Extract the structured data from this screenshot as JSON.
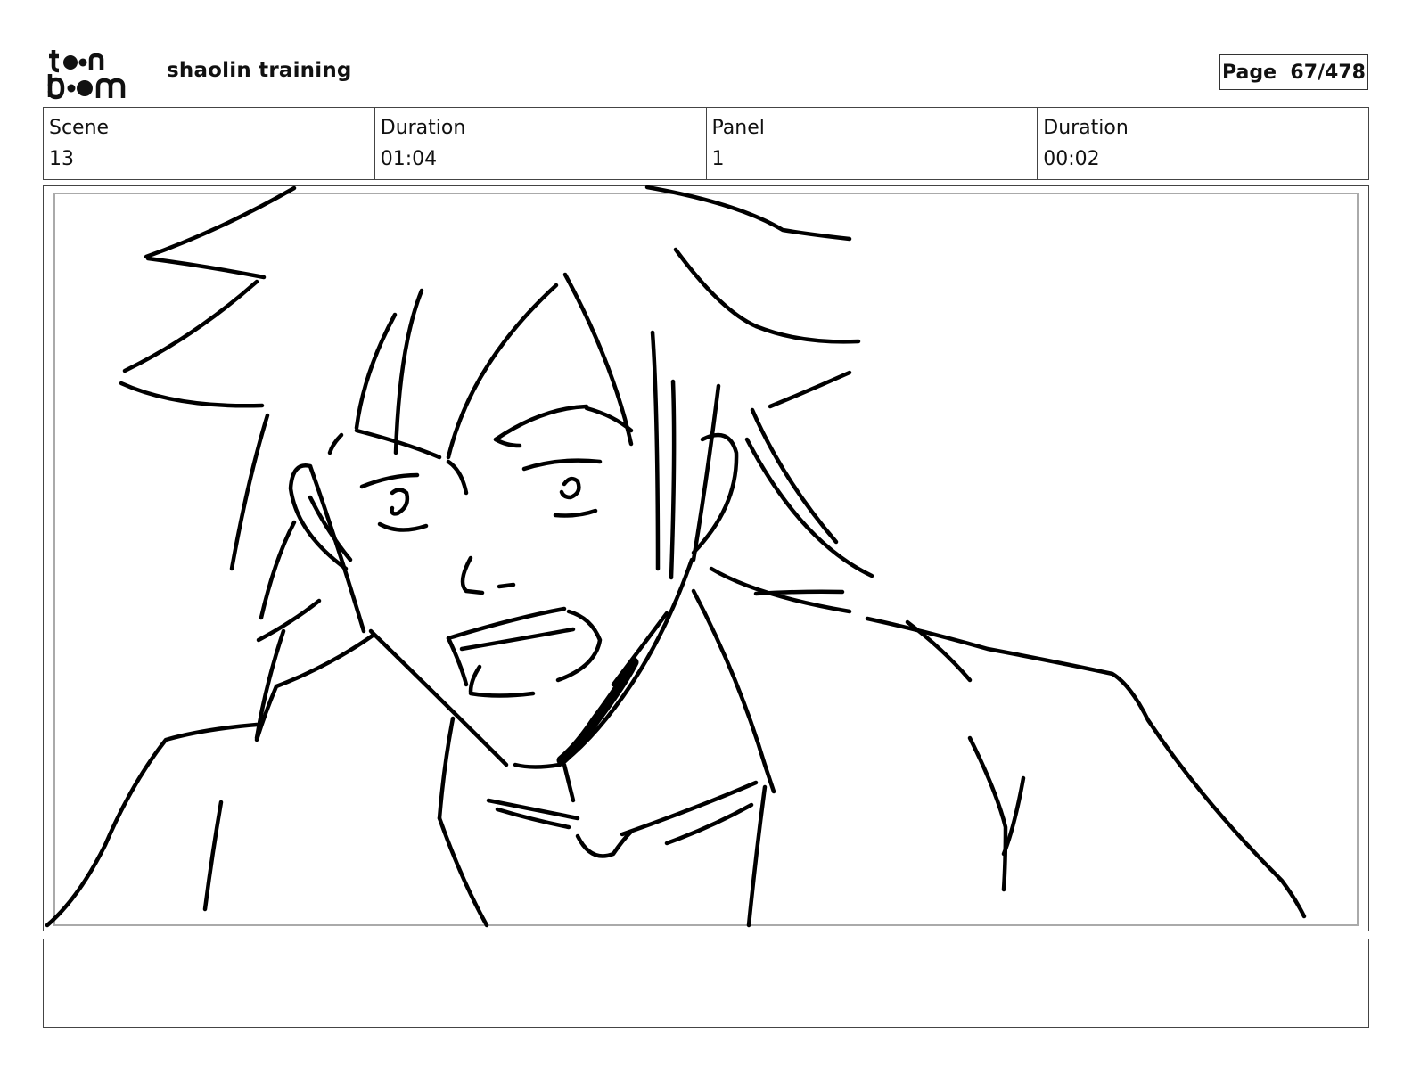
{
  "header": {
    "logo_text": "toonboom",
    "project_title": "shaolin training",
    "page_label": "Page",
    "page_value": "67/478"
  },
  "info": {
    "scene_label": "Scene",
    "scene_value": "13",
    "scene_duration_label": "Duration",
    "scene_duration_value": "01:04",
    "panel_label": "Panel",
    "panel_value": "1",
    "panel_duration_label": "Duration",
    "panel_duration_value": "00:02"
  },
  "panel": {
    "sketch_icon": "character-sketch",
    "stroke_color": "#000000"
  },
  "notes": {
    "text": ""
  }
}
